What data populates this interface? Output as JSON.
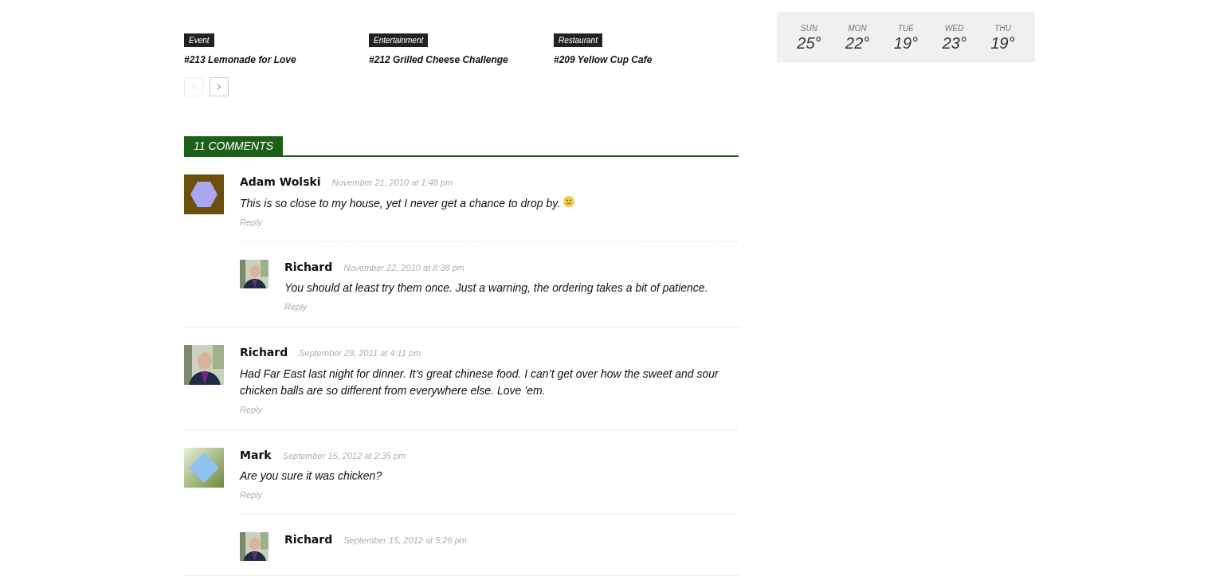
{
  "related_posts": [
    {
      "category": "Event",
      "title": "#213 Lemonade for Love"
    },
    {
      "category": "Entertainment",
      "title": "#212 Grilled Cheese Challenge"
    },
    {
      "category": "Restaurant",
      "title": "#209 Yellow Cup Cafe"
    }
  ],
  "pager": {
    "prev_disabled": true,
    "next_disabled": false
  },
  "comments_heading": "11 COMMENTS",
  "comments": [
    {
      "author": "Adam Wolski",
      "avatar": {
        "kind": "hexagon"
      },
      "date": "November 21, 2010 at 1:48 pm",
      "text": "This is so close to my house, yet I never get a chance to drop by.",
      "emoji": true,
      "reply": "Reply",
      "children": [
        {
          "author": "Richard",
          "date": "November 22, 2010 at 8:38 pm",
          "text": "You should at least try them once. Just a warning, the ordering takes a bit of patience.",
          "reply": "Reply"
        }
      ]
    },
    {
      "author": "Richard",
      "date": "September 29, 2011 at 4:11 pm",
      "text": "Had Far East last night for dinner. It’s great chinese food. I can’t get over how the sweet and sour chicken balls are so different from everywhere else. Love ’em.",
      "reply": "Reply"
    },
    {
      "author": "Mark",
      "avatar": {
        "kind": "diamond"
      },
      "date": "September 15, 2012 at 2:35 pm",
      "text": "Are you sure it was chicken?",
      "reply": "Reply",
      "children": [
        {
          "author": "Richard",
          "date": "September 15, 2012 at 5:26 pm"
        }
      ]
    }
  ],
  "weather_forecast": [
    {
      "day": "SUN",
      "temp": "25°"
    },
    {
      "day": "MON",
      "temp": "22°"
    },
    {
      "day": "TUE",
      "temp": "19°"
    },
    {
      "day": "WED",
      "temp": "23°"
    },
    {
      "day": "THU",
      "temp": "19°"
    }
  ]
}
